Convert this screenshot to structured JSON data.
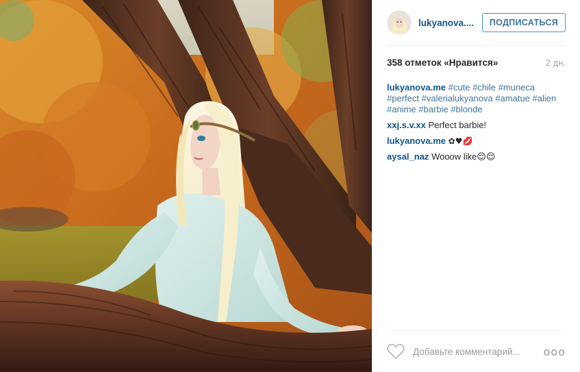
{
  "post": {
    "image_alt": "Blonde woman with headband leaning on tree branch in autumn forest"
  },
  "header": {
    "username": "lukyanova....",
    "follow_label": "ПОДПИСАТЬСЯ"
  },
  "stats": {
    "likes": "358 отметок «Нравится»",
    "time": "2 дн."
  },
  "caption": {
    "user": "lukyanova.me",
    "tags": [
      "#cute",
      "#chile",
      "#muneca",
      "#perfect",
      "#valerialukyanova",
      "#amatue",
      "#alien",
      "#anime",
      "#barbie",
      "#blonde"
    ]
  },
  "comments": [
    {
      "user": "xxj.s.v.xx",
      "text": "Perfect barbie!"
    },
    {
      "user": "lukyanova.me",
      "text": "✿♥💋"
    },
    {
      "user": "aysal_naz",
      "text": "Wooow like😌😌"
    }
  ],
  "footer": {
    "comment_placeholder": "Добавьте комментарий...",
    "more_label": "ооо"
  },
  "colors": {
    "link": "#125688",
    "hashtag": "#3f729b",
    "follow_border": "#4090db"
  }
}
